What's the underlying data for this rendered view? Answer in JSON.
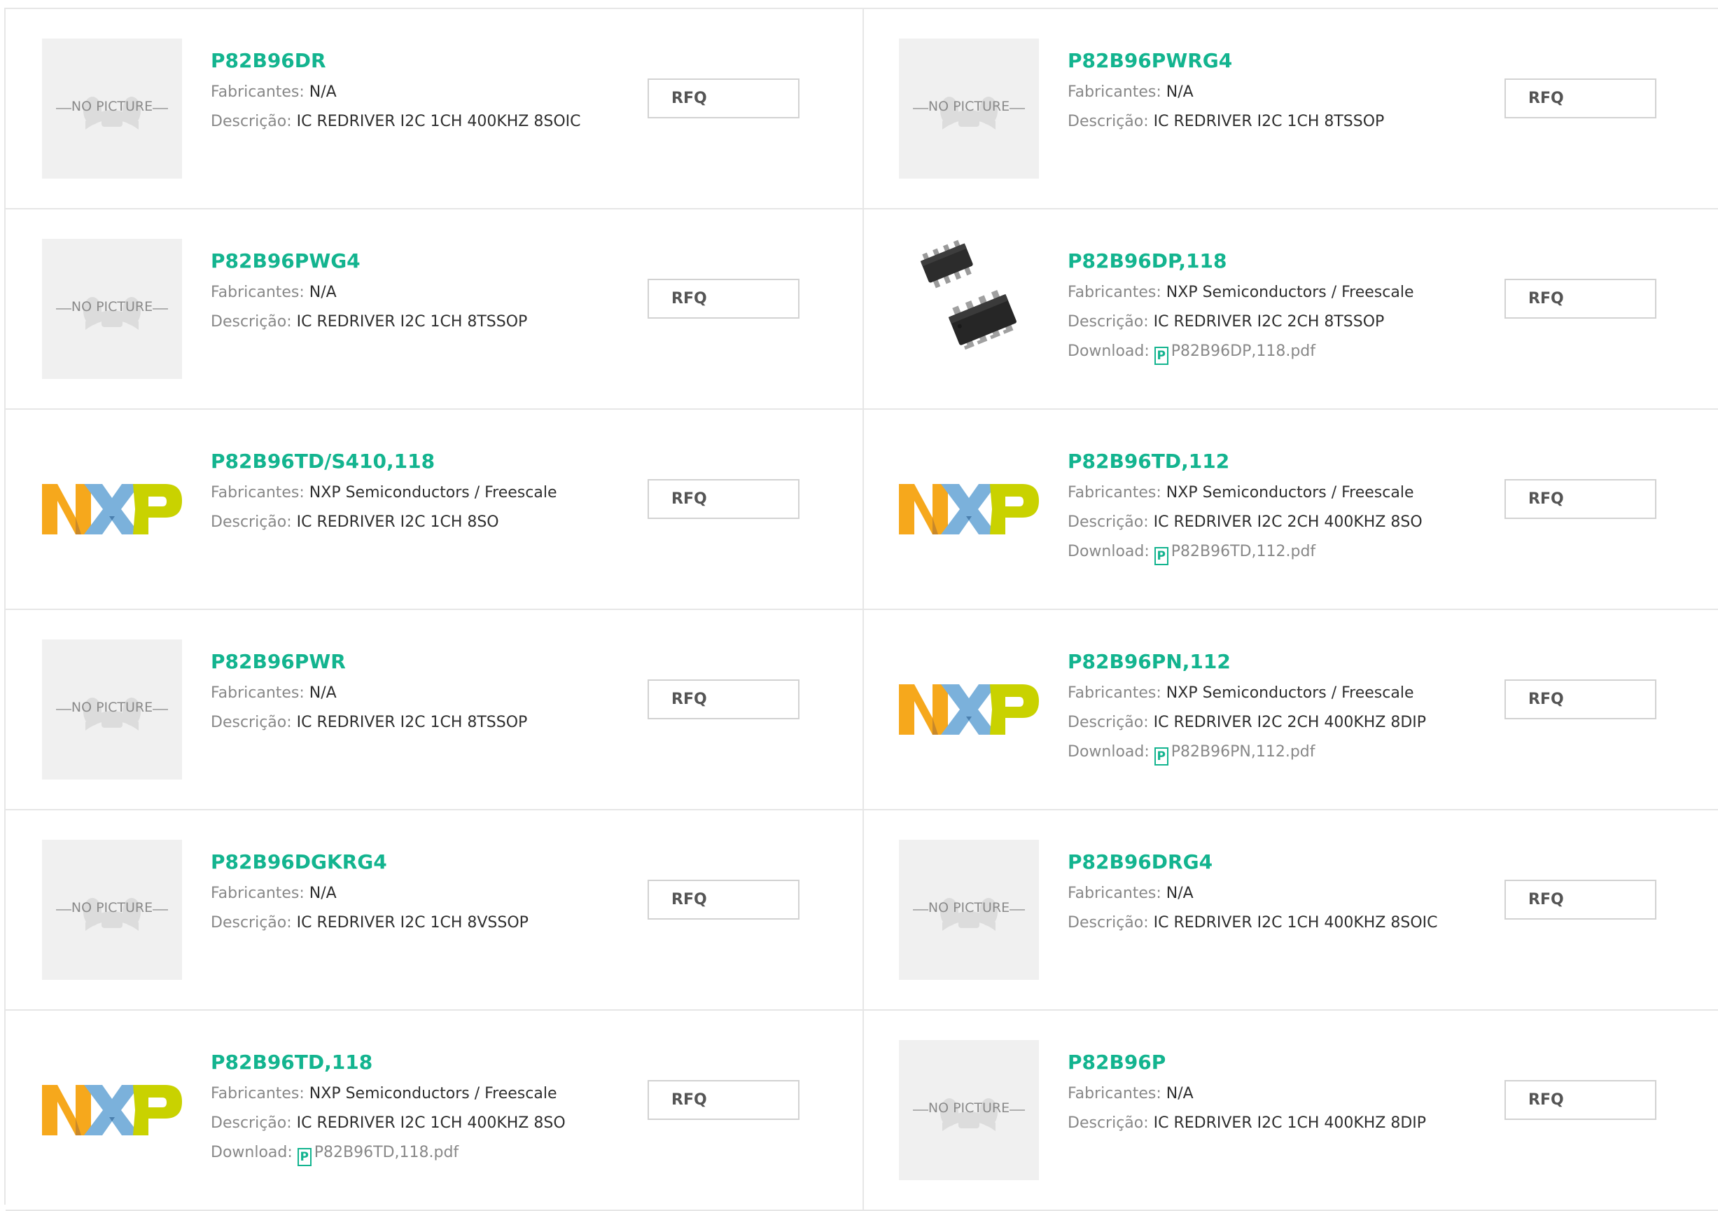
{
  "labels": {
    "manufacturer": "Fabricantes:",
    "description": "Descrição:",
    "download": "Download:",
    "rfq": "RFQ",
    "no_picture": "NO PICTURE",
    "pdf_glyph": "P"
  },
  "colors": {
    "accent_green": "#13b48f",
    "nxp_orange": "#f6a81c",
    "nxp_blue": "#7bb1db",
    "nxp_green": "#c9d200"
  },
  "products": [
    {
      "name": "P82B96DR",
      "manufacturer": "N/A",
      "description": "IC REDRIVER I2C 1CH 400KHZ 8SOIC",
      "image": "no-picture",
      "download": null
    },
    {
      "name": "P82B96PWRG4",
      "manufacturer": "N/A",
      "description": "IC REDRIVER I2C 1CH 8TSSOP",
      "image": "no-picture",
      "download": null
    },
    {
      "name": "P82B96PWG4",
      "manufacturer": "N/A",
      "description": "IC REDRIVER I2C 1CH 8TSSOP",
      "image": "no-picture",
      "download": null
    },
    {
      "name": "P82B96DP,118",
      "manufacturer": "NXP Semiconductors / Freescale",
      "description": "IC REDRIVER I2C 2CH 8TSSOP",
      "image": "chip-photo",
      "download": "P82B96DP,118.pdf"
    },
    {
      "name": "P82B96TD/S410,118",
      "manufacturer": "NXP Semiconductors / Freescale",
      "description": "IC REDRIVER I2C 1CH 8SO",
      "image": "nxp-logo",
      "download": null
    },
    {
      "name": "P82B96TD,112",
      "manufacturer": "NXP Semiconductors / Freescale",
      "description": "IC REDRIVER I2C 2CH 400KHZ 8SO",
      "image": "nxp-logo",
      "download": "P82B96TD,112.pdf"
    },
    {
      "name": "P82B96PWR",
      "manufacturer": "N/A",
      "description": "IC REDRIVER I2C 1CH 8TSSOP",
      "image": "no-picture",
      "download": null
    },
    {
      "name": "P82B96PN,112",
      "manufacturer": "NXP Semiconductors / Freescale",
      "description": "IC REDRIVER I2C 2CH 400KHZ 8DIP",
      "image": "nxp-logo",
      "download": "P82B96PN,112.pdf"
    },
    {
      "name": "P82B96DGKRG4",
      "manufacturer": "N/A",
      "description": "IC REDRIVER I2C 1CH 8VSSOP",
      "image": "no-picture",
      "download": null
    },
    {
      "name": "P82B96DRG4",
      "manufacturer": "N/A",
      "description": "IC REDRIVER I2C 1CH 400KHZ 8SOIC",
      "image": "no-picture",
      "download": null
    },
    {
      "name": "P82B96TD,118",
      "manufacturer": "NXP Semiconductors / Freescale",
      "description": "IC REDRIVER I2C 1CH 400KHZ 8SO",
      "image": "nxp-logo",
      "download": "P82B96TD,118.pdf"
    },
    {
      "name": "P82B96P",
      "manufacturer": "N/A",
      "description": "IC REDRIVER I2C 1CH 400KHZ 8DIP",
      "image": "no-picture",
      "download": null
    }
  ]
}
